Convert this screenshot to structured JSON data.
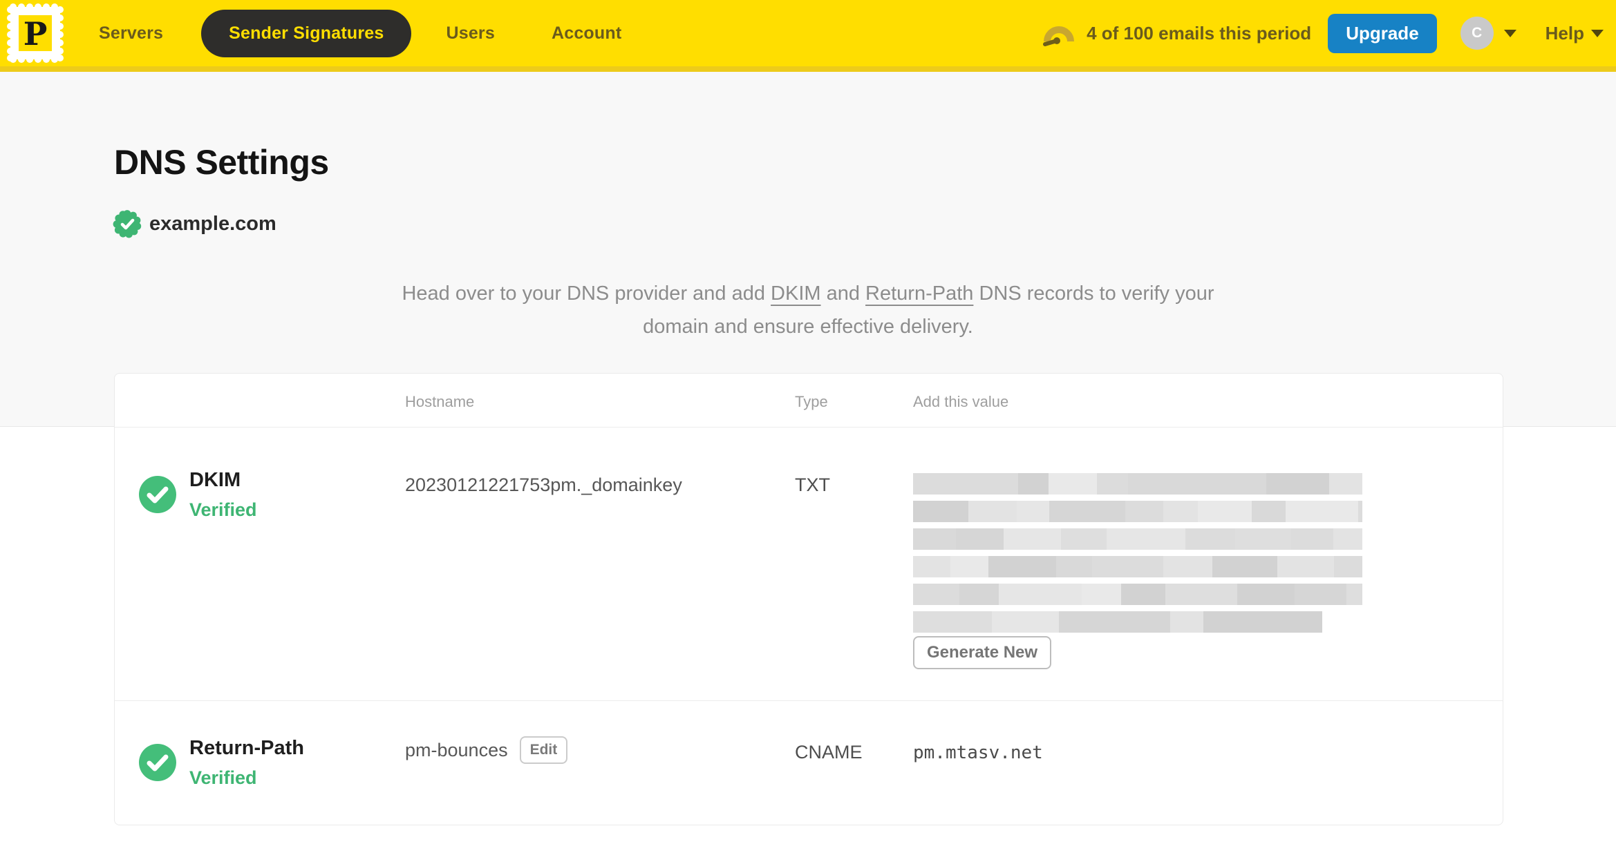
{
  "nav": {
    "logo_letter": "P",
    "items": [
      {
        "label": "Servers",
        "active": false
      },
      {
        "label": "Sender Signatures",
        "active": true
      },
      {
        "label": "Users",
        "active": false
      },
      {
        "label": "Account",
        "active": false
      }
    ],
    "usage_text": "4 of 100 emails this period",
    "upgrade_label": "Upgrade",
    "avatar_initial": "C",
    "help_label": "Help"
  },
  "page": {
    "title": "DNS Settings",
    "domain": "example.com",
    "domain_verified": true,
    "intro": {
      "part1": "Head over to your DNS provider and add ",
      "link_dkim": "DKIM",
      "part2": " and ",
      "link_return_path": "Return-Path",
      "part3": " DNS records to verify your domain and ensure effective delivery."
    }
  },
  "table": {
    "headers": {
      "hostname": "Hostname",
      "type": "Type",
      "value": "Add this value"
    },
    "rows": [
      {
        "name": "DKIM",
        "status": "Verified",
        "hostname": "20230121221753pm._domainkey",
        "type": "TXT",
        "value_redacted": true,
        "value_redacted_rows": 6,
        "value_last_row_ratio": 0.91,
        "action_label": "Generate New"
      },
      {
        "name": "Return-Path",
        "status": "Verified",
        "hostname": "pm-bounces",
        "edit_label": "Edit",
        "type": "CNAME",
        "value": "pm.mtasv.net"
      }
    ]
  },
  "colors": {
    "brand_yellow": "#FFDE00",
    "nav_active_pill": "#2E2D2B",
    "upgrade_blue": "#1782C5",
    "verified_green": "#3EB573"
  }
}
